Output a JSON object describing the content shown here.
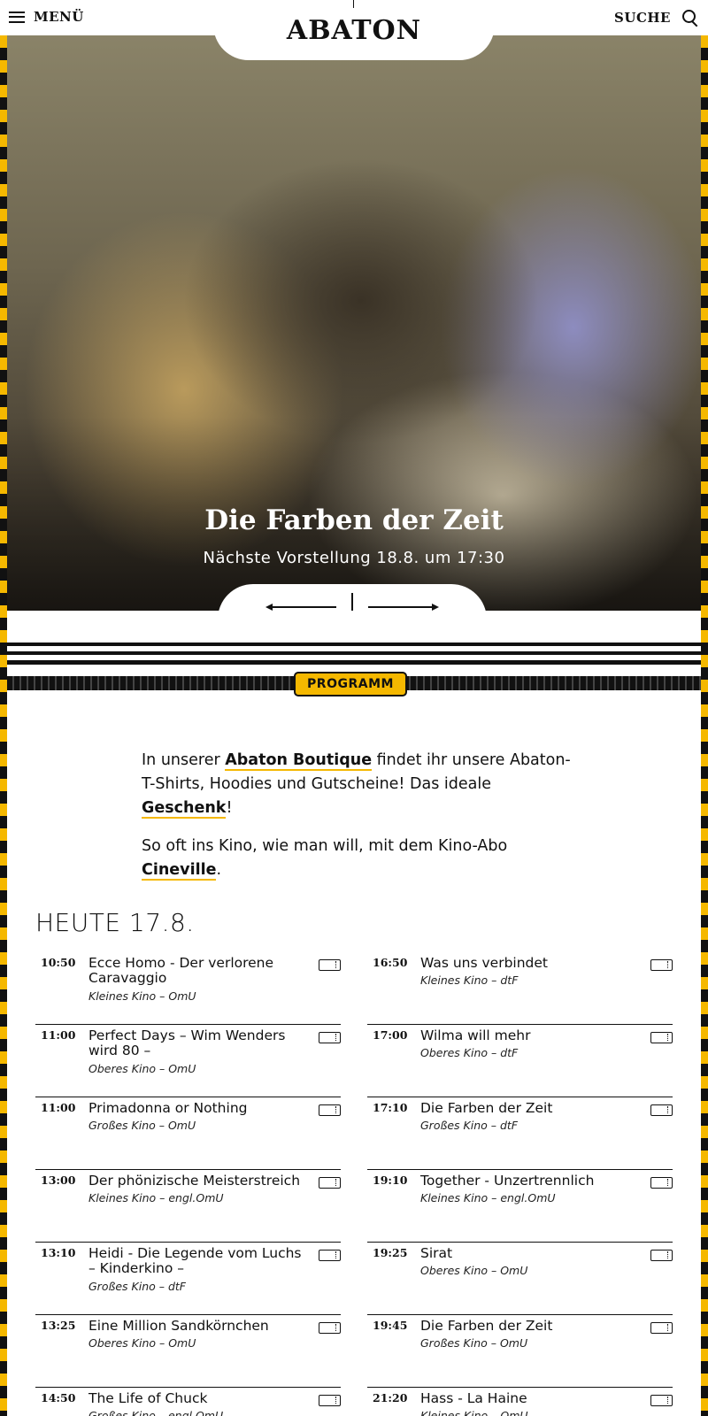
{
  "header": {
    "menu_label": "MENÜ",
    "logo": "ABATON",
    "search_label": "SUCHE"
  },
  "hero": {
    "title": "Die Farben der Zeit",
    "subtitle": "Nächste Vorstellung 18.8. um 17:30"
  },
  "program_tag": "PROGRAMM",
  "intro": {
    "p1_pre": "In unserer ",
    "p1_link1": "Abaton Boutique",
    "p1_mid": " findet ihr unsere Abaton-T-Shirts, Hoodies und Gutscheine! Das ideale ",
    "p1_link2": "Geschenk",
    "p1_post": "!",
    "p2_pre": "So oft ins Kino, wie man will, mit dem Kino-Abo ",
    "p2_link": "Cineville",
    "p2_post": "."
  },
  "today_label": "HEUTE 17.8.",
  "colors": {
    "accent": "#f5b800",
    "ink": "#111111"
  },
  "shows_left": [
    {
      "time": "10:50",
      "title": "Ecce Homo - Der verlorene Caravaggio",
      "meta": "Kleines Kino – OmU"
    },
    {
      "time": "11:00",
      "title": "Perfect Days – Wim Wenders wird 80 –",
      "meta": "Oberes Kino – OmU"
    },
    {
      "time": "11:00",
      "title": "Primadonna or Nothing",
      "meta": "Großes Kino – OmU"
    },
    {
      "time": "13:00",
      "title": "Der phönizische Meisterstreich",
      "meta": "Kleines Kino – engl.OmU"
    },
    {
      "time": "13:10",
      "title": "Heidi - Die Legende vom Luchs – Kinderkino –",
      "meta": "Großes Kino – dtF"
    },
    {
      "time": "13:25",
      "title": "Eine Million Sandkörnchen",
      "meta": "Oberes Kino – OmU"
    },
    {
      "time": "14:50",
      "title": "The Life of Chuck",
      "meta": "Großes Kino – engl.OmU"
    }
  ],
  "shows_right": [
    {
      "time": "16:50",
      "title": "Was uns verbindet",
      "meta": "Kleines Kino – dtF"
    },
    {
      "time": "17:00",
      "title": "Wilma will mehr",
      "meta": "Oberes Kino – dtF"
    },
    {
      "time": "17:10",
      "title": "Die Farben der Zeit",
      "meta": "Großes Kino – dtF"
    },
    {
      "time": "19:10",
      "title": "Together - Unzertrennlich",
      "meta": "Kleines Kino – engl.OmU"
    },
    {
      "time": "19:25",
      "title": "Sirat",
      "meta": "Oberes Kino – OmU"
    },
    {
      "time": "19:45",
      "title": "Die Farben der Zeit",
      "meta": "Großes Kino – OmU"
    },
    {
      "time": "21:20",
      "title": "Hass - La Haine",
      "meta": "Kleines Kino – OmU"
    }
  ]
}
